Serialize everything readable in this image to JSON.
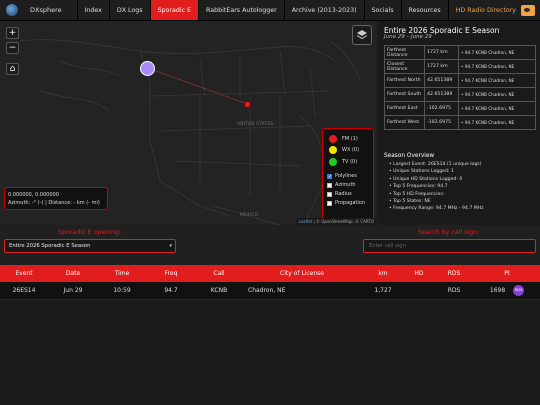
{
  "app": {
    "brand": "DXsphere"
  },
  "nav": {
    "items": [
      {
        "label": "Index"
      },
      {
        "label": "DX Logs"
      },
      {
        "label": "Sporadic E"
      },
      {
        "label": "RabbitEars Autologger"
      },
      {
        "label": "Archive (2013-2023)"
      },
      {
        "label": "Socials"
      },
      {
        "label": "Resources"
      },
      {
        "label": "HD Radio Directory"
      }
    ],
    "active": "Sporadic E"
  },
  "map": {
    "zoom_in": "+",
    "zoom_out": "−",
    "home": "⌂",
    "layers_icon": "layers-icon",
    "labels": {
      "us": "UNITED STATES",
      "mexico": "MEXICO"
    },
    "coords": "0.000000, 0.000000",
    "azimuth": "Azimuth: -° (-) | Distance: - km (- mi)",
    "legend": {
      "fm": "FM (1)",
      "wx": "WX (0)",
      "tv": "TV (0)",
      "colors": {
        "fm": "#e11d1d",
        "wx": "#f2e600",
        "tv": "#22cc22"
      }
    },
    "options": [
      {
        "label": "Polylines",
        "checked": true
      },
      {
        "label": "Azimuth",
        "checked": false
      },
      {
        "label": "Radius",
        "checked": false
      },
      {
        "label": "Propagation",
        "checked": false
      }
    ],
    "attribution": {
      "leaflet": "Leaflet",
      "rest": " | © OpenStreetMap, © CARTO"
    }
  },
  "season": {
    "title": "Entire 2026 Sporadic E Season",
    "dates": "June 29 – June 29",
    "stats": [
      {
        "label": "Farthest Distance",
        "value": "1727 km",
        "station": "94.7 KCNB Chadron, NE"
      },
      {
        "label": "Closest Distance",
        "value": "1727 km",
        "station": "94.7 KCNB Chadron, NE"
      },
      {
        "label": "Farthest North",
        "value": "42.651389",
        "station": "94.7 KCNB Chadron, NE"
      },
      {
        "label": "Farthest South",
        "value": "42.651389",
        "station": "94.7 KCNB Chadron, NE"
      },
      {
        "label": "Farthest East",
        "value": "-102.6975",
        "station": "94.7 KCNB Chadron, NE"
      },
      {
        "label": "Farthest West",
        "value": "-102.6975",
        "station": "94.7 KCNB Chadron, NE"
      }
    ],
    "overview_title": "Season Overview",
    "overview": [
      "Largest Event: 26ES14 (1 unique logs)",
      "Unique Stations Logged: 1",
      "Unique HD Stations Logged: 0",
      "Top 5 Frequencies: 94.7",
      "Top 5 HD Frequencies:",
      "Top 5 States: NE",
      "Frequency Range: 94.7 MHz - 94.7 MHz"
    ]
  },
  "filters": {
    "opening_label": "Sporadic E opening:",
    "opening_value": "Entire 2026 Sporadic E Season",
    "search_label": "Search by call sign:",
    "search_placeholder": "Enter call sign"
  },
  "log": {
    "headers": [
      "Event",
      "Date",
      "Time",
      "Freq",
      "Call",
      "City of License",
      "km",
      "HD",
      "RDS",
      "PI"
    ],
    "rows": [
      {
        "event": "26ES14",
        "date": "Jun 29",
        "time": "10:59",
        "freq": "94.7",
        "call": "KCNB",
        "city": "Chadron, NE",
        "km": "1,727",
        "hd": "",
        "rds": "RDS",
        "pi": "1698",
        "badge": "RDS"
      }
    ]
  }
}
